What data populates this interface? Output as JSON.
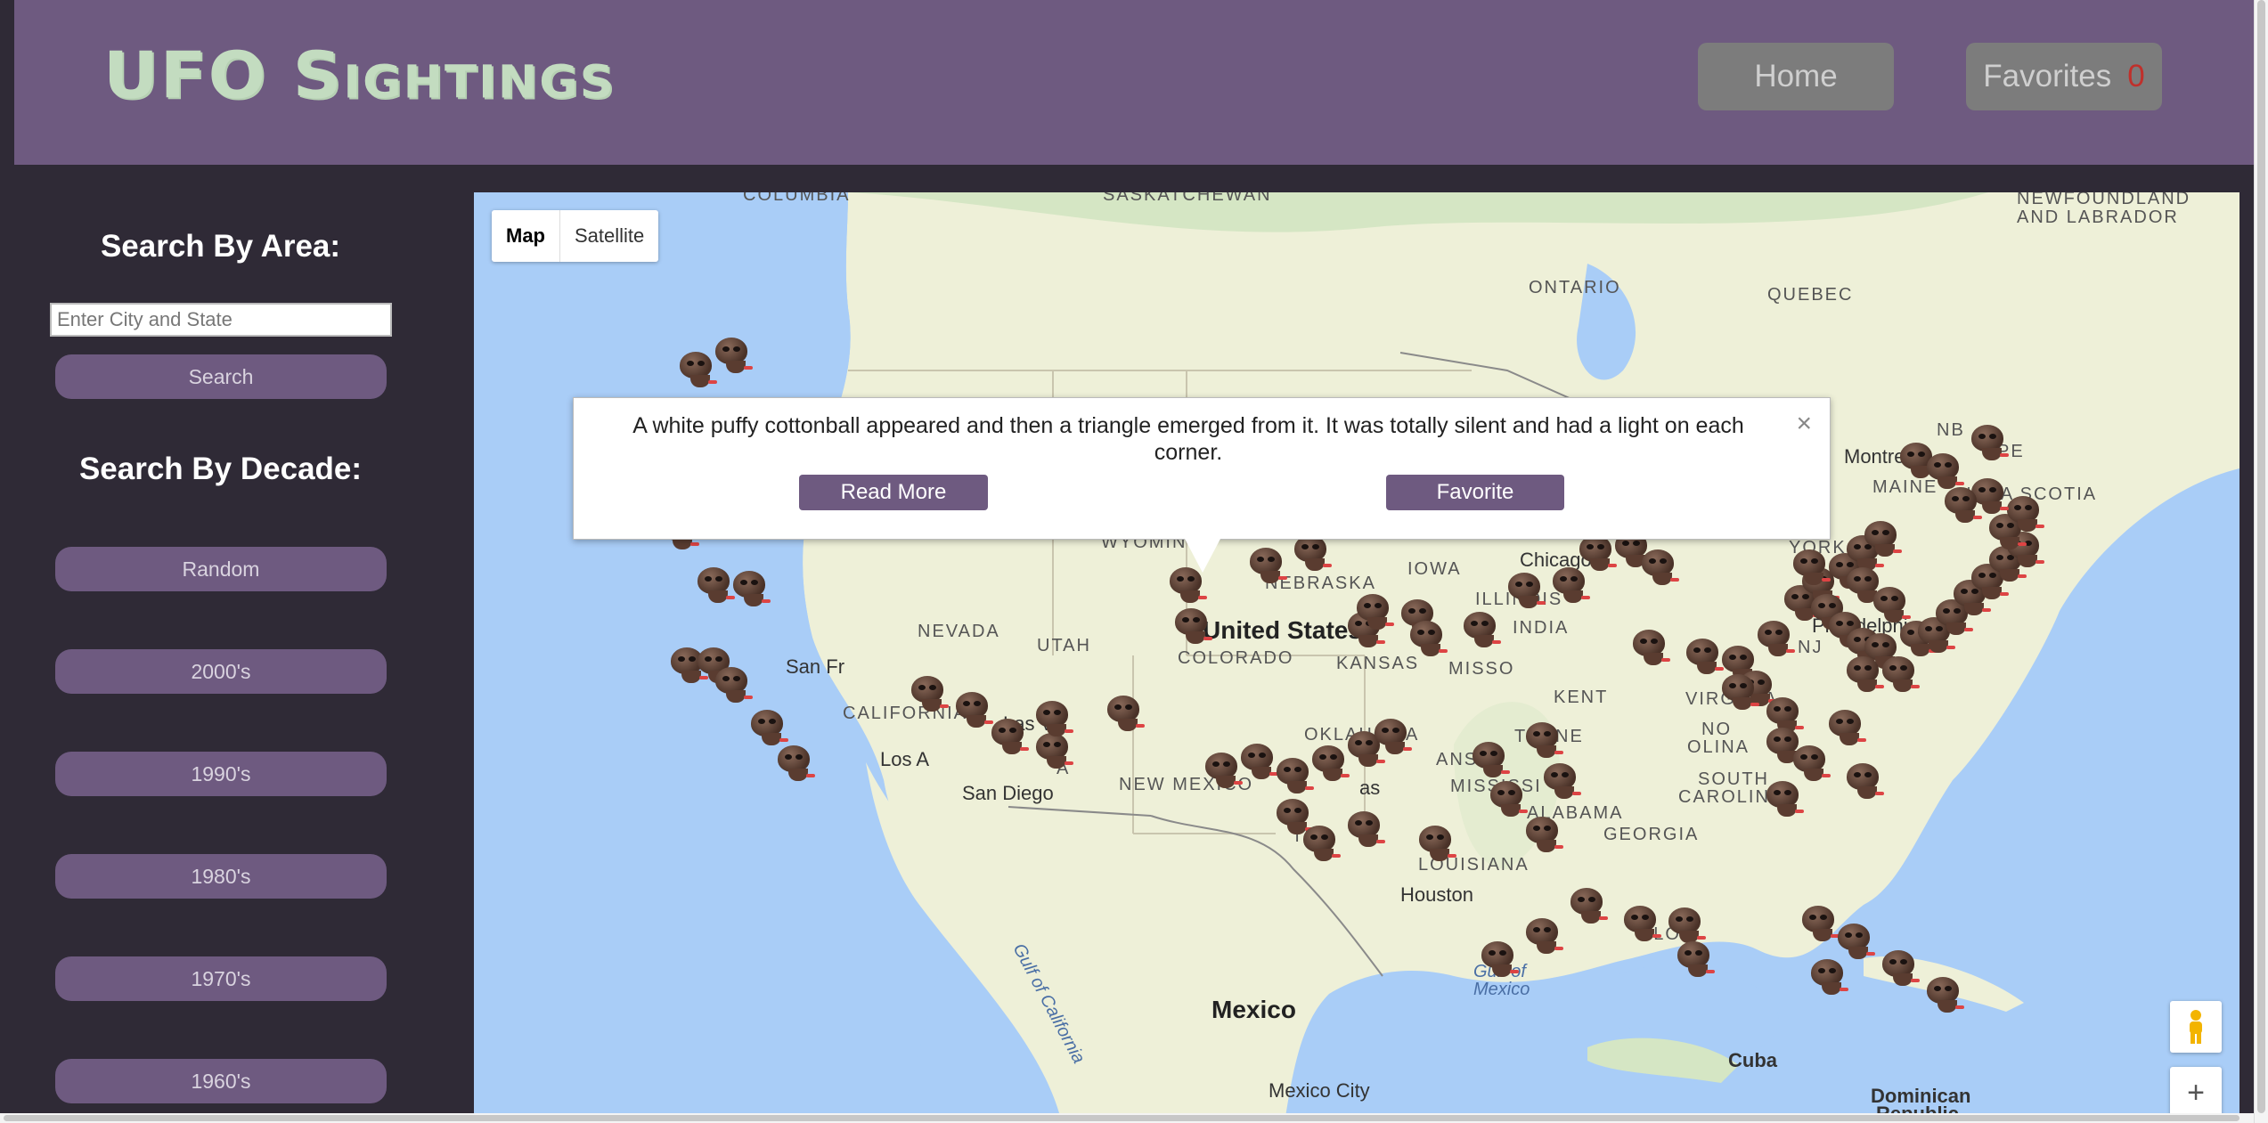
{
  "header": {
    "title": "UFO Sightings",
    "nav": {
      "home_label": "Home",
      "favorites_label": "Favorites",
      "favorites_count": "0"
    }
  },
  "sidebar": {
    "area_heading": "Search By Area:",
    "search_placeholder": "Enter City and State",
    "search_button": "Search",
    "decade_heading": "Search By Decade:",
    "decades": [
      "Random",
      "2000's",
      "1990's",
      "1980's",
      "1970's",
      "1960's"
    ]
  },
  "map": {
    "type_controls": {
      "map_label": "Map",
      "satellite_label": "Satellite",
      "selected": "Map"
    },
    "labels": {
      "columbia": "COLUMBIA",
      "saskatchewan": "SASKATCHEWAN",
      "newfoundland": "NEWFOUNDLAND",
      "labrador": "AND LABRADOR",
      "ontario": "ONTARIO",
      "quebec": "QUEBEC",
      "nb": "NB",
      "pe": "PE",
      "montreal": "Montreal",
      "maine": "MAINE",
      "nova_scotia": "NOVA SCOTIA",
      "wyoming": "WYOMIN",
      "nebraska": "NEBRASKA",
      "iowa": "IOWA",
      "chicago": "Chicago",
      "illinois": "ILLINOIS",
      "indiana": "INDIA",
      "york": "YORK",
      "nevada": "NEVADA",
      "utah": "UTAH",
      "united_states": "United States",
      "philadelphia": "Philadelphia",
      "nj": "NJ",
      "colorado": "COLORADO",
      "kansas": "KANSAS",
      "missouri": "MISSO",
      "san_francisco": "San Fr",
      "california": "CALIFORNIA",
      "las_vegas": "Las V",
      "kentucky": "KENT",
      "virginia": "VIRGINIA",
      "oklahoma": "OKLAHOMA",
      "tennessee": "TENNE",
      "north_carolina": "NO",
      "los_angeles": "Los A",
      "arizona": "A",
      "arkansas": "ANSAS",
      "carolina": "OLINA",
      "san_diego": "San Diego",
      "new_mexico": "NEW MEXICO",
      "dallas": "as",
      "mississippi": "MISSISSI",
      "south_carolina_1": "SOUTH",
      "south_carolina_2": "CAROLINA",
      "alabama": "ALABAMA",
      "texas": "TEX",
      "georgia": "GEORGIA",
      "louisiana": "LOUISIANA",
      "houston": "Houston",
      "florida": "FLO",
      "gulf_california": "Gulf of California",
      "gulf_mexico_1": "Gulf of",
      "gulf_mexico_2": "Mexico",
      "mexico": "Mexico",
      "cuba": "Cuba",
      "mexico_city": "Mexico City",
      "dominican_1": "Dominican",
      "dominican_2": "Republic"
    },
    "zoom_in_label": "+",
    "pegman_icon": "pegman-icon"
  },
  "info_window": {
    "text": "A white puffy cottonball appeared and then a triangle emerged from it. It was totally silent and had a light on each corner.",
    "read_more_label": "Read More",
    "favorite_label": "Favorite",
    "close_label": "×"
  },
  "colors": {
    "header_bg": "#6e5a80",
    "sidebar_bg": "#2f2a36",
    "accent": "#6e5a80",
    "logo": "#c3dcc0",
    "fav_count": "#c0302b"
  }
}
